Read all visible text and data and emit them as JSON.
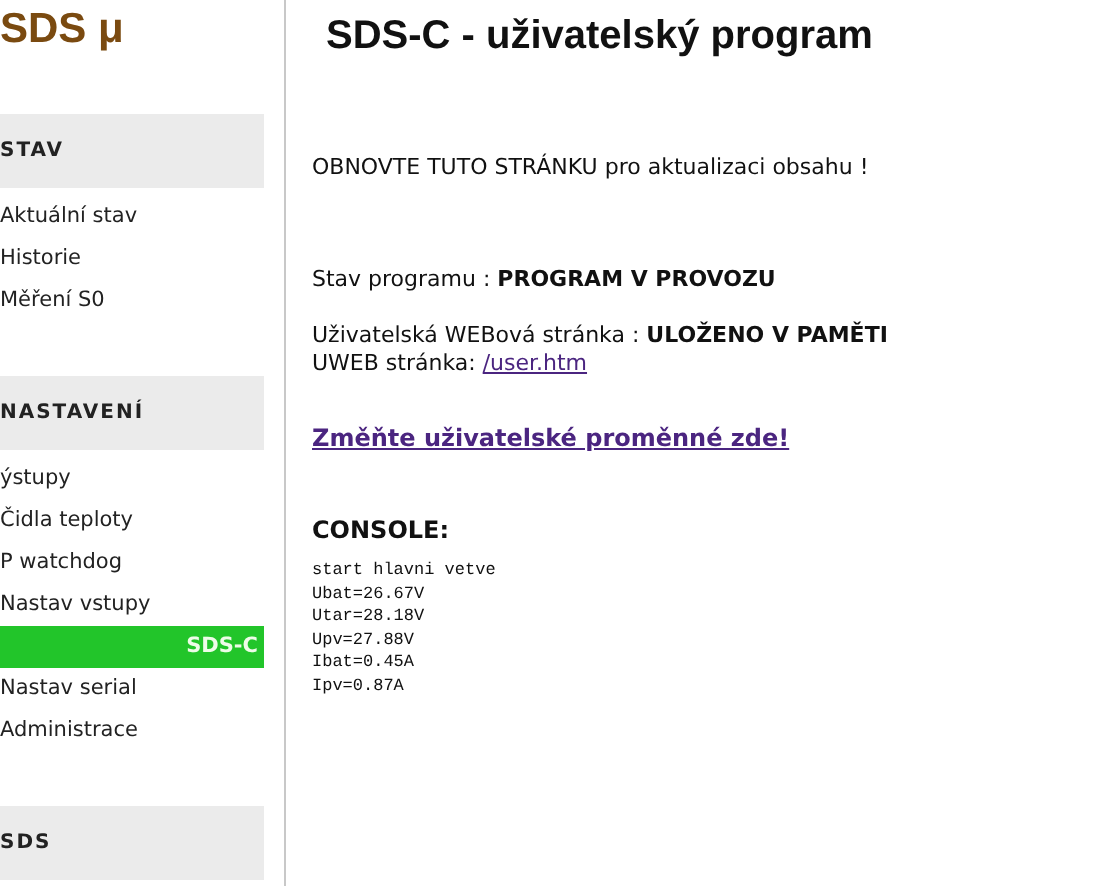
{
  "logo": "SDS μ",
  "sidebar": {
    "sections": [
      {
        "title": "STAV",
        "items": [
          {
            "label": "Aktuální stav",
            "selected": false
          },
          {
            "label": "Historie",
            "selected": false
          },
          {
            "label": "Měření S0",
            "selected": false
          }
        ]
      },
      {
        "title": "NASTAVENÍ",
        "items": [
          {
            "label": "ýstupy",
            "selected": false
          },
          {
            "label": "Čidla teploty",
            "selected": false
          },
          {
            "label": "P watchdog",
            "selected": false
          },
          {
            "label": "Nastav vstupy",
            "selected": false
          },
          {
            "label": "SDS-C",
            "selected": true
          },
          {
            "label": "Nastav serial",
            "selected": false
          },
          {
            "label": "Administrace",
            "selected": false
          }
        ]
      },
      {
        "title": "SDS"
      }
    ]
  },
  "page_title": "SDS-C - uživatelský program",
  "notice": "OBNOVTE TUTO STRÁNKU pro aktualizaci obsahu !",
  "program_status": "Stav programu : **PROGRAM V PROVOZU**",
  "web_status": "Uživatelská WEBová stránka : **ULOŽENO V PAMĚTI**",
  "uweb_label": "UWEB stránka:",
  "uweb_link": "/user.htm",
  "change_link": "Změňte uživatelské proměnné zde!",
  "console": {
    "title": "CONSOLE:",
    "lines": [
      "start hlavni vetve",
      "Ubat=26.67V",
      "Utar=28.18V",
      "Upv=27.88V",
      "Ibat=0.45A",
      "Ipv=0.87A"
    ]
  }
}
